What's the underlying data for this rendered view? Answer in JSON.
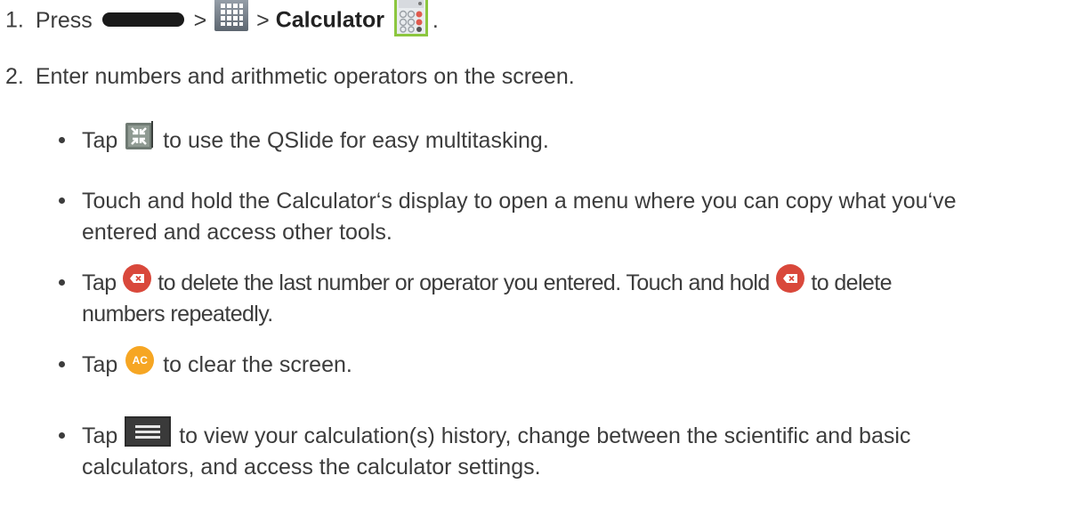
{
  "steps": [
    {
      "number": "1.",
      "press": "Press",
      "sep1": ">",
      "sep2": ">",
      "calculator": "Calculator",
      "end": ".",
      "icons": [
        "home-button-icon",
        "apps-grid-icon",
        "calculator-app-icon"
      ]
    },
    {
      "number": "2.",
      "text": "Enter numbers and arithmetic operators on the screen."
    }
  ],
  "bullets": {
    "qslide": {
      "tap": "Tap",
      "rest": "to use the QSlide for easy multitasking.",
      "icon": "qslide-icon"
    },
    "hold": {
      "line1": "Touch and hold the Calculator‘s display to open a menu where you can copy what you‘ve",
      "line2": "entered and access other tools."
    },
    "delete": {
      "tap": "Tap",
      "mid": "to delete the last number or operator you entered. Touch and hold",
      "end": "to delete",
      "line2": "numbers repeatedly.",
      "icon": "delete-key-icon"
    },
    "clear": {
      "tap": "Tap",
      "icon_label": "AC",
      "rest": "to clear the screen.",
      "icon": "clear-ac-icon"
    },
    "history": {
      "tap": "Tap",
      "line1": "to view your calculation(s) history, change between the scientific and basic",
      "line2": "calculators, and access the calculator settings.",
      "icon": "menu-icon"
    }
  },
  "colors": {
    "text": "#3c3c3c",
    "delete_red": "#d9483b",
    "ac_orange": "#f6a623",
    "calc_green": "#8cc63f"
  }
}
